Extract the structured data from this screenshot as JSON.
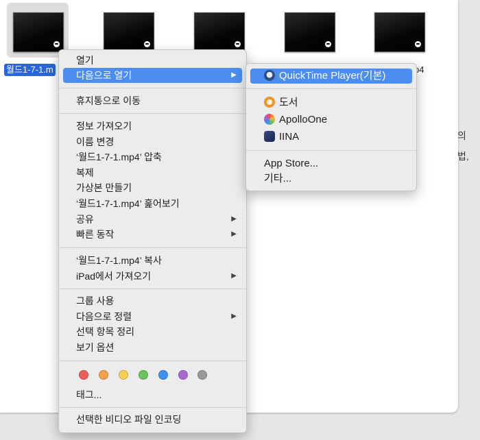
{
  "finder": {
    "selected_file_label": "월드1-7-1.m",
    "partial_file_label": "p4",
    "side_text_1": "의",
    "side_text_2": "법,"
  },
  "context_menu": {
    "items": [
      {
        "label": "열기"
      },
      {
        "label": "다음으로 열기"
      },
      {
        "label": "휴지통으로 이동"
      },
      {
        "label": "정보 가져오기"
      },
      {
        "label": "이름 변경"
      },
      {
        "label": "‘월드1-7-1.mp4’ 압축"
      },
      {
        "label": "복제"
      },
      {
        "label": "가상본 만들기"
      },
      {
        "label": "‘월드1-7-1.mp4’ 훑어보기"
      },
      {
        "label": "공유"
      },
      {
        "label": "빠른 동작"
      },
      {
        "label": "‘월드1-7-1.mp4’ 복사"
      },
      {
        "label": "iPad에서 가져오기"
      },
      {
        "label": "그룹 사용"
      },
      {
        "label": "다음으로 정렬"
      },
      {
        "label": "선택 항목 정리"
      },
      {
        "label": "보기 옵션"
      },
      {
        "label": "태그..."
      },
      {
        "label": "선택한 비디오 파일 인코딩"
      }
    ],
    "submenu_arrow": "▶",
    "tag_colors": [
      {
        "name": "red",
        "color": "#ec5f5a"
      },
      {
        "name": "orange",
        "color": "#f5a04a"
      },
      {
        "name": "yellow",
        "color": "#f7cf55"
      },
      {
        "name": "green",
        "color": "#6cc55e"
      },
      {
        "name": "blue",
        "color": "#3d8ff0"
      },
      {
        "name": "purple",
        "color": "#a869d0"
      },
      {
        "name": "gray",
        "color": "#9a9a9a"
      }
    ]
  },
  "open_with_submenu": {
    "items": [
      {
        "label": "QuickTime Player(기본)",
        "icon": "quicktime-icon"
      },
      {
        "label": "도서",
        "icon": "books-icon"
      },
      {
        "label": "ApolloOne",
        "icon": "apolloone-icon"
      },
      {
        "label": "IINA",
        "icon": "iina-icon"
      },
      {
        "label": "App Store..."
      },
      {
        "label": "기타..."
      }
    ]
  },
  "colors": {
    "highlight": "#4b8df0",
    "selection": "#2a66d8"
  }
}
